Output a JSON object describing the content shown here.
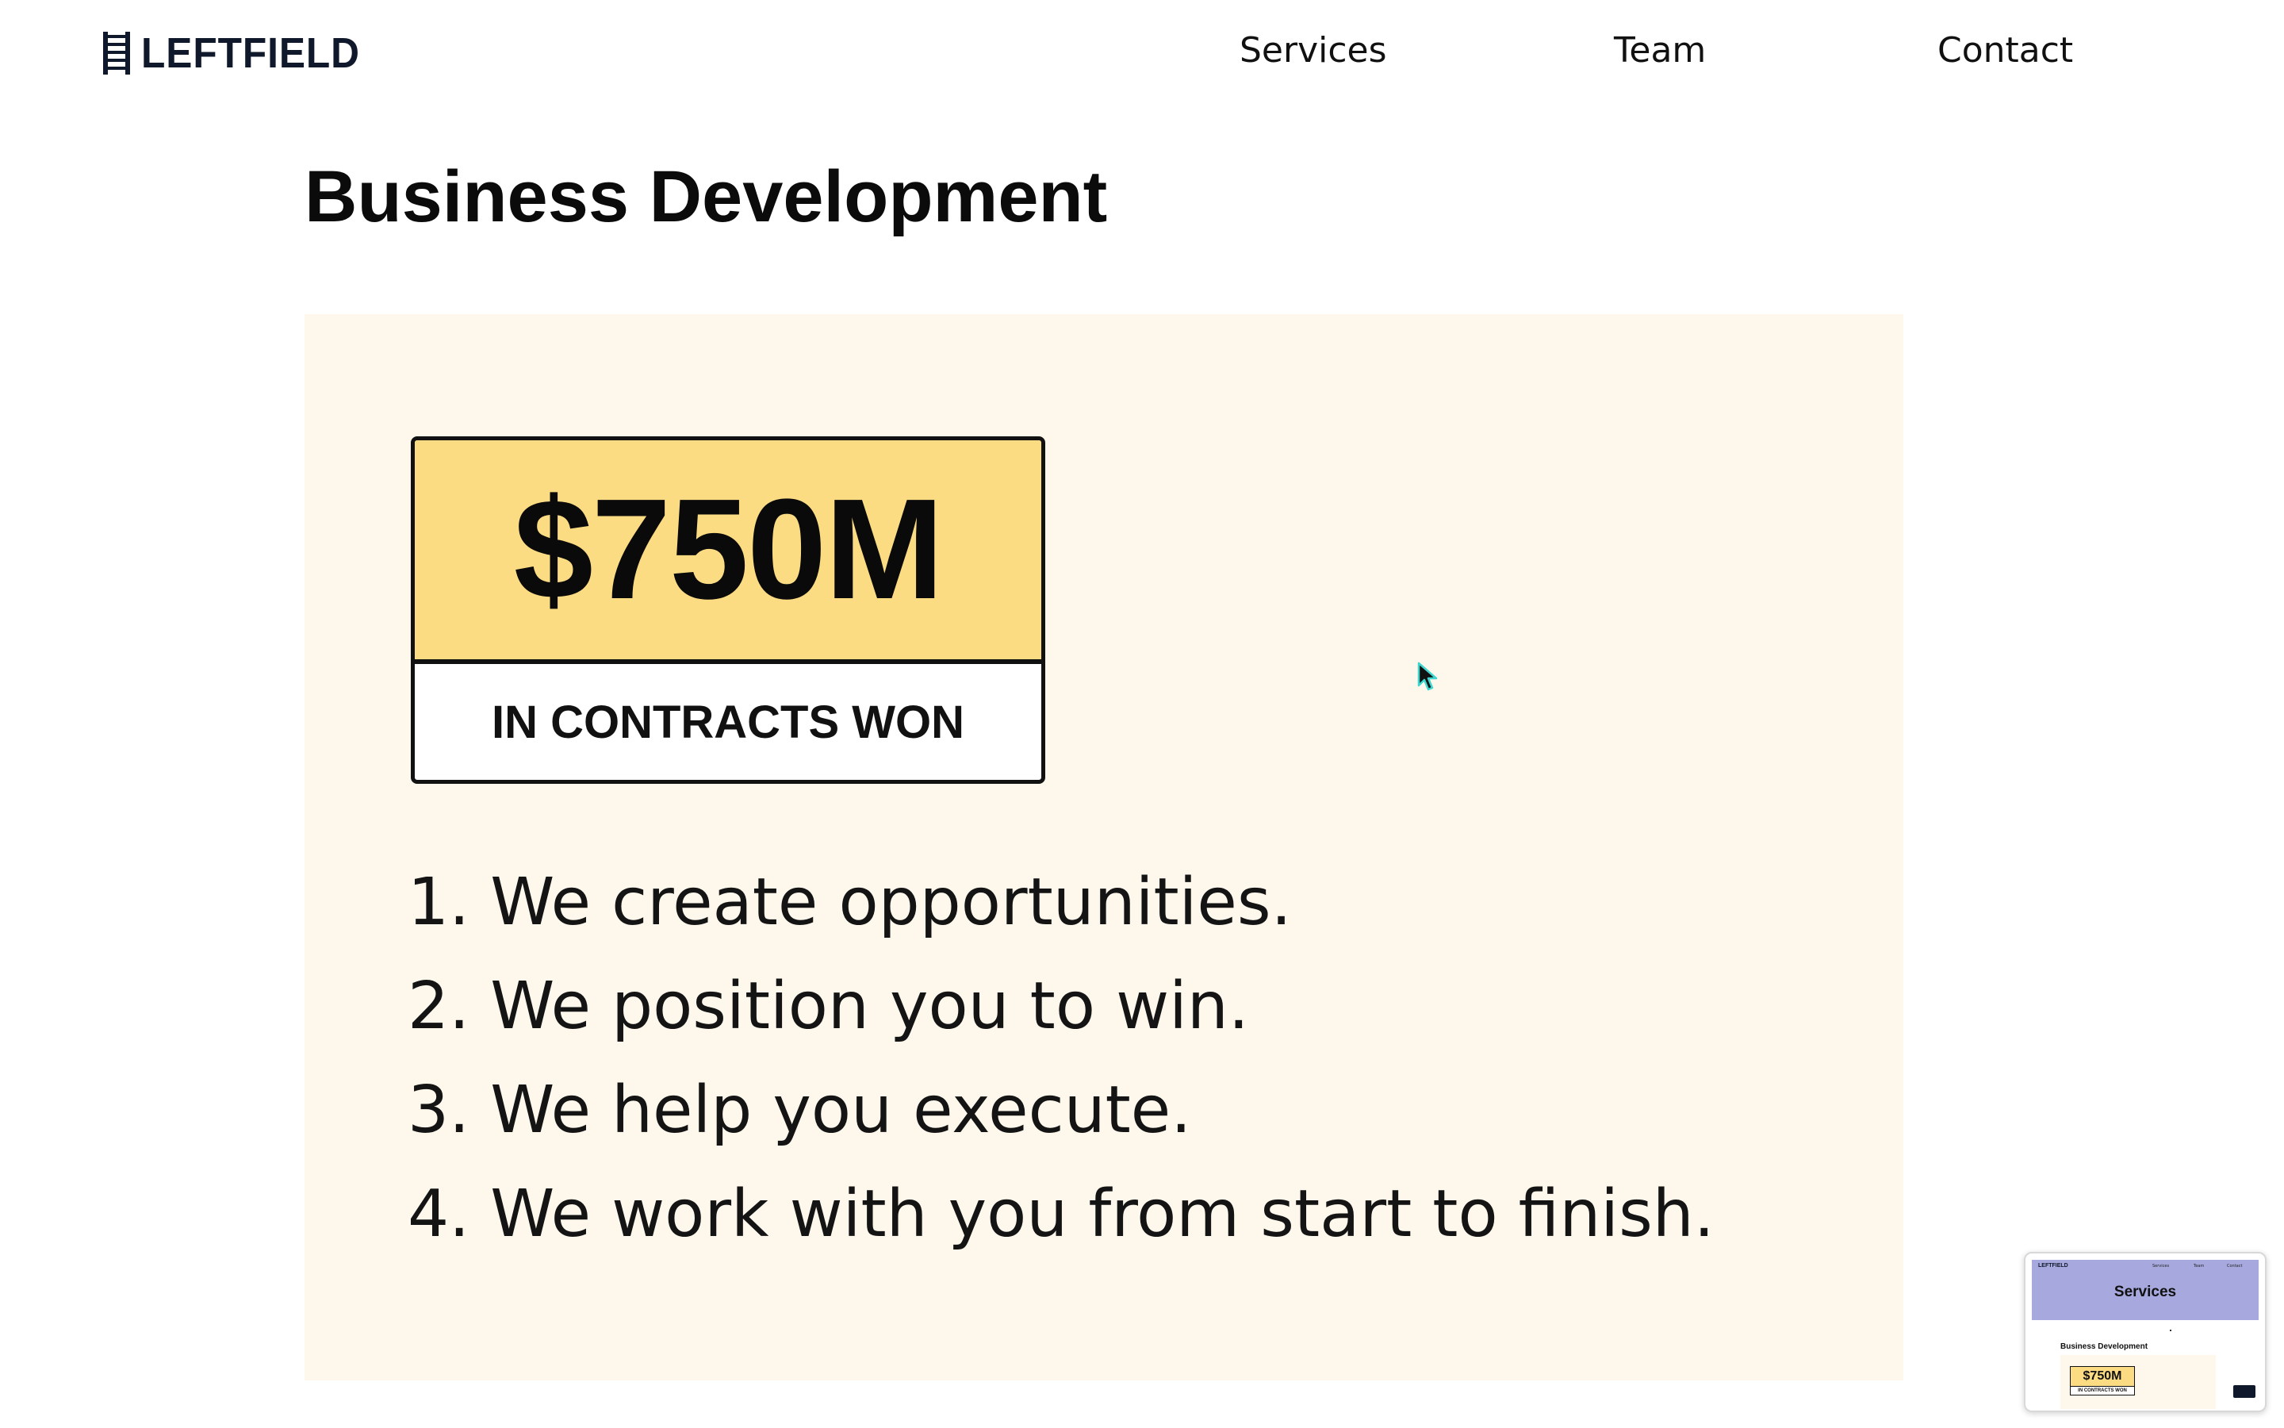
{
  "header": {
    "logo_text": "LEFTFIELD",
    "nav": [
      {
        "label": "Services"
      },
      {
        "label": "Team"
      },
      {
        "label": "Contact"
      }
    ]
  },
  "page": {
    "title": "Business Development"
  },
  "card": {
    "stat_value": "$750M",
    "stat_label": "IN CONTRACTS WON",
    "steps": [
      "1. We create opportunities.",
      "2. We position you to win.",
      "3. We help you execute.",
      "4. We work with you from start to finish."
    ]
  },
  "minimap": {
    "brand": "LEFTFIELD",
    "nav": [
      "Services",
      "Team",
      "Contact"
    ],
    "hero_title": "Services",
    "section_title": "Business Development",
    "stat_value": "$750M",
    "stat_label": "IN CONTRACTS WON"
  },
  "colors": {
    "brand_navy": "#10192b",
    "card_background": "#fdf7ec",
    "stat_highlight": "#fcdc82",
    "minimap_hero": "#a7a9de",
    "cursor_glow": "#3fd6cf"
  },
  "icons": {
    "logo": "ladder-icon",
    "pointer": "mouse-cursor-icon"
  }
}
